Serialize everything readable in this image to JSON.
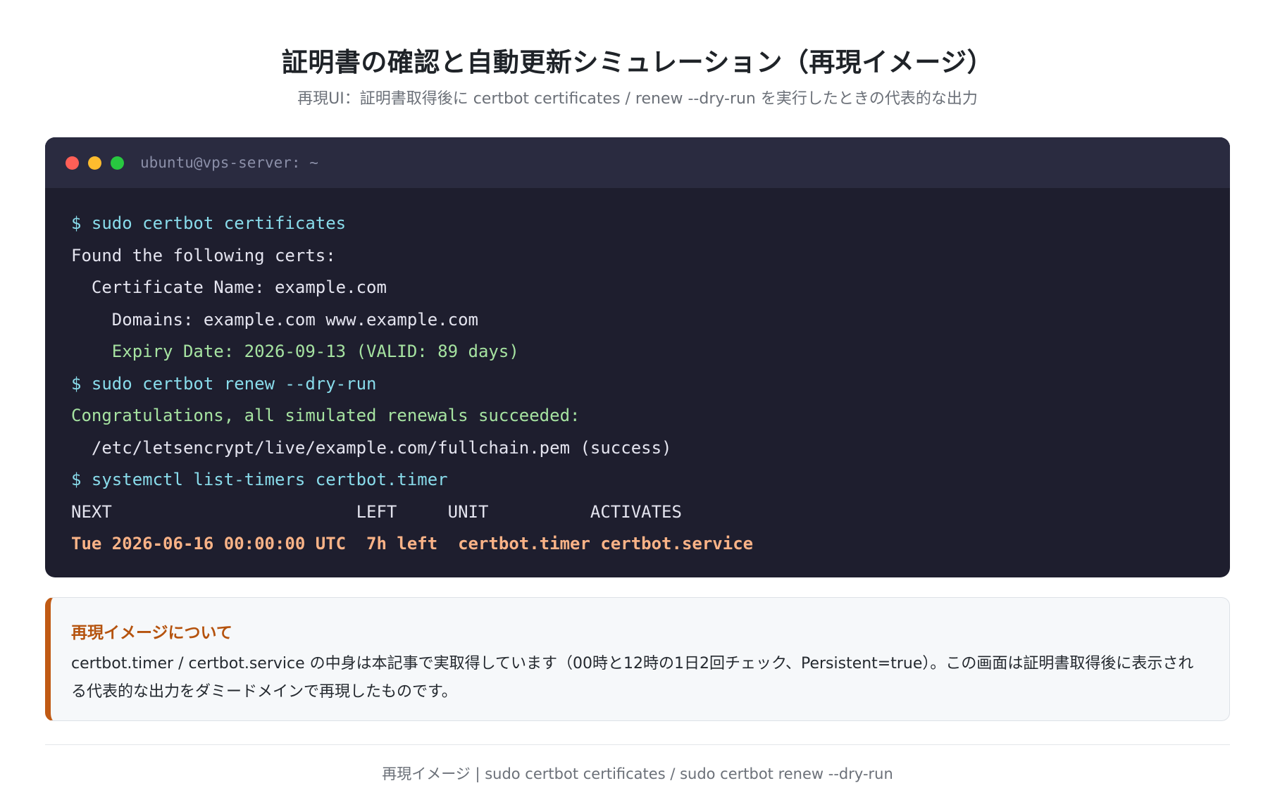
{
  "header": {
    "title": "証明書の確認と自動更新シミュレーション（再現イメージ）",
    "subtitle": "再現UI：証明書取得後に certbot certificates / renew --dry-run を実行したときの代表的な出力"
  },
  "terminal": {
    "window_title": "ubuntu@vps-server: ~",
    "lines": [
      {
        "text": "$ sudo certbot certificates",
        "style": "cmd"
      },
      {
        "text": "Found the following certs:",
        "style": "normal"
      },
      {
        "text": "  Certificate Name: example.com",
        "style": "normal"
      },
      {
        "text": "    Domains: example.com www.example.com",
        "style": "normal"
      },
      {
        "text": "    Expiry Date: 2026-09-13 (VALID: 89 days)",
        "style": "ok"
      },
      {
        "text": "$ sudo certbot renew --dry-run",
        "style": "cmd"
      },
      {
        "text": "Congratulations, all simulated renewals succeeded:",
        "style": "ok"
      },
      {
        "text": "  /etc/letsencrypt/live/example.com/fullchain.pem (success)",
        "style": "normal"
      },
      {
        "text": "$ systemctl list-timers certbot.timer",
        "style": "cmd"
      },
      {
        "text": "NEXT                        LEFT     UNIT          ACTIVATES",
        "style": "normal"
      },
      {
        "text": "Tue 2026-06-16 00:00:00 UTC  7h left  certbot.timer certbot.service",
        "style": "hl"
      }
    ]
  },
  "note": {
    "title": "再現イメージについて",
    "text": "certbot.timer / certbot.service の中身は本記事で実取得しています（00時と12時の1日2回チェック、Persistent=true）。この画面は証明書取得後に表示される代表的な出力をダミードメインで再現したものです。"
  },
  "footer": {
    "text": "再現イメージ | sudo certbot certificates / sudo certbot renew --dry-run"
  },
  "colors": {
    "terminal_bg": "#1e1e2e",
    "titlebar_bg": "#2a2b40",
    "command": "#89dceb",
    "success": "#a6e3a1",
    "highlight": "#fab387",
    "note_accent": "#c05a14"
  }
}
